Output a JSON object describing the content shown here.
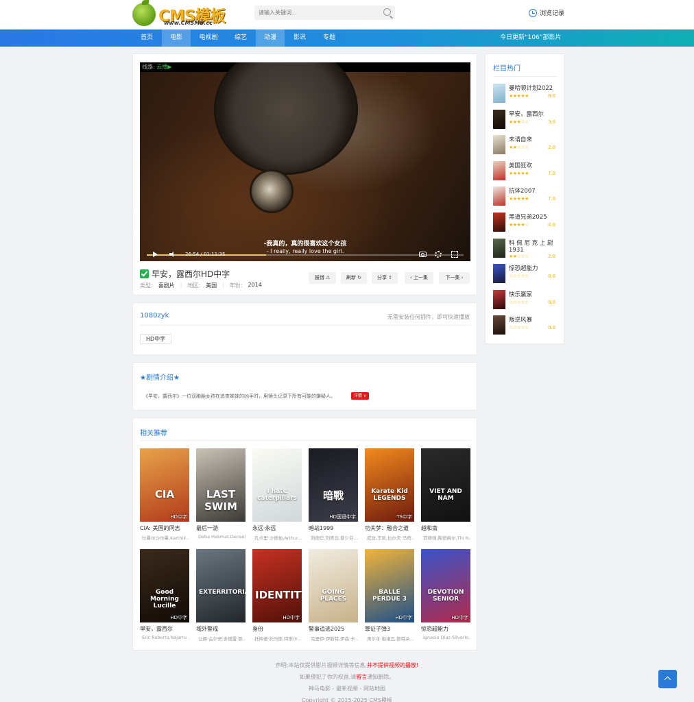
{
  "header": {
    "logo_text": "CMS模板",
    "logo_sub": "www.CMSMB.cc",
    "search_placeholder": "请输入关键词...",
    "history_label": "浏览记录"
  },
  "nav": {
    "items": [
      {
        "label": "首页",
        "active": false
      },
      {
        "label": "电影",
        "active": true
      },
      {
        "label": "电视剧",
        "active": false
      },
      {
        "label": "综艺",
        "active": false
      },
      {
        "label": "动漫",
        "active": true
      },
      {
        "label": "影讯",
        "active": false
      },
      {
        "label": "专题",
        "active": false
      }
    ],
    "update_text": "今日更新“106”部影片"
  },
  "player": {
    "route_label": "线路:",
    "route_name": "云播▶",
    "subtitle_cn": "-我真的，真的很喜欢这个女孩",
    "subtitle_en": "- I really, really love the girl.",
    "time": "26:54 / 01:11:35",
    "progress": 0.376
  },
  "movie": {
    "title": "早安，露西尔HD中字",
    "type_label": "类型:",
    "type_value": "喜剧片",
    "region_label": "地区:",
    "region_value": "美国",
    "year_label": "年份:",
    "year_value": "2014",
    "actions": [
      "报错 ⚠",
      "刷新 ↻",
      "分享 ⇧",
      "‹ 上一集",
      "下一集 ›"
    ]
  },
  "source": {
    "name": "1080zyk",
    "tip": "无需安装任何插件，即可快速播放",
    "episode": "HD中字"
  },
  "intro": {
    "title": "★剧情介绍★",
    "text": "《早安，露西尔》一位双胞胎女孩在追查妹妹的凶手时，用镜头记录下所有可能的嫌疑人。",
    "detail": "详情 ∨"
  },
  "related": {
    "title": "相关推荐",
    "movies": [
      {
        "name": "CIA: 美国的同志",
        "actors": "杜曼尔沙尔曼,Karthik...",
        "badge": "HD中字",
        "art": "CIA",
        "colors": [
          "#e8a34a",
          "#b23a1a"
        ]
      },
      {
        "name": "最后一游",
        "actors": "Deba Hekmat,Densel...",
        "badge": "",
        "art": "LAST SWIM",
        "colors": [
          "#c9c2b6",
          "#3c3a36"
        ]
      },
      {
        "name": "永远·永远",
        "actors": "孔卡里·沙德帕,Arthur...",
        "badge": "",
        "art": "I hate caterpillars",
        "colors": [
          "#fbfbf4",
          "#cfd8da"
        ]
      },
      {
        "name": "暗战1999",
        "actors": "刘德华,刘青云,蔡少芬...",
        "badge": "HD国语中字",
        "art": "暗戰",
        "colors": [
          "#1a1a22",
          "#3d3d4a"
        ]
      },
      {
        "name": "功夫梦：融合之道",
        "actors": "成龙,王凯,拉尔夫·马奇...",
        "badge": "TS中字",
        "art": "Karate Kid LEGENDS",
        "colors": [
          "#f38a1e",
          "#6e1a0c"
        ]
      },
      {
        "name": "越和南",
        "actors": "范德强,陶德梅尔,Thi N...",
        "badge": "",
        "art": "VIET AND NAM",
        "colors": [
          "#2a2a2a",
          "#111"
        ]
      },
      {
        "name": "早安，露西尔",
        "actors": "Eric Roberts,Najarra ...",
        "badge": "HD中字",
        "art": "Good Morning Lucille",
        "colors": [
          "#3a2a1c",
          "#120b06"
        ]
      },
      {
        "name": "域外警戒",
        "actors": "让娜·古尔安,多德雷·斯...",
        "badge": "",
        "art": "EXTERRITORIAL",
        "colors": [
          "#6a7680",
          "#22262a"
        ]
      },
      {
        "name": "身份",
        "actors": "托梅诺·托马斯,特斯尔...",
        "badge": "HD中字",
        "art": "IDENTITY",
        "colors": [
          "#c63122",
          "#521009"
        ]
      },
      {
        "name": "警事追逃2025",
        "actors": "克里伊·伊斯特,伊森·卡...",
        "badge": "",
        "art": "GOING PLACES",
        "colors": [
          "#f1ece0",
          "#c7b28a"
        ]
      },
      {
        "name": "罪证子弹3",
        "actors": "奥尔本·勒维瓦,德特朵...",
        "badge": "HD中字",
        "art": "BALLE PERDUE 3",
        "colors": [
          "#f2b53a",
          "#1c4f8a"
        ]
      },
      {
        "name": "惊恐超能力",
        "actors": "Ignacio Diaz-Silverio,...",
        "badge": "HD中字",
        "art": "DEVOTION SENIOR",
        "colors": [
          "#3a54c9",
          "#b12a4a"
        ]
      }
    ]
  },
  "sidebar": {
    "title": "栏目热门",
    "items": [
      {
        "name": "曼哈顿计划2022",
        "stars": 5,
        "score": "8.0",
        "colors": [
          "#cfe4ef",
          "#7fb1cc"
        ]
      },
      {
        "name": "早安，露西尔",
        "stars": 3,
        "score": "3.0",
        "colors": [
          "#3a2a1c",
          "#120b06"
        ]
      },
      {
        "name": "未请自来",
        "stars": 2,
        "score": "2.0",
        "colors": [
          "#e9e2d2",
          "#8a7a64"
        ]
      },
      {
        "name": "美国狂欢",
        "stars": 5,
        "score": "7.0",
        "colors": [
          "#e8d3c0",
          "#c0302a"
        ]
      },
      {
        "name": "抗体2007",
        "stars": 5,
        "score": "7.0",
        "colors": [
          "#f0e8e0",
          "#b8342a"
        ]
      },
      {
        "name": "黑道兄弟2025",
        "stars": 4,
        "score": "4.0",
        "colors": [
          "#c8321e",
          "#2a1008"
        ]
      },
      {
        "name": "科 佩 尼 克 上 尉 1931",
        "stars": 2,
        "score": "2.0",
        "colors": [
          "#5a6a4a",
          "#1e2418"
        ]
      },
      {
        "name": "惊恐超能力",
        "stars": 0,
        "score": "0.0",
        "colors": [
          "#3a54c9",
          "#1a1a3a"
        ]
      },
      {
        "name": "快乐赢家",
        "stars": 0,
        "score": "0.0",
        "colors": [
          "#c83a3a",
          "#2a0a0a"
        ]
      },
      {
        "name": "叛逆风暴",
        "stars": 0,
        "score": "0.0",
        "colors": [
          "#6a4a3a",
          "#1a0e08"
        ]
      }
    ]
  },
  "footer": {
    "disclaimer_a": "声明:本站仅提供影片视频详情等信息,",
    "disclaimer_b": "并不提供视频的播放!",
    "notice_a": "如果侵犯了你的权益,请",
    "notice_red": "留言",
    "notice_b": "通知删除。",
    "links": "神马电影 - 最新视频 - 网站地图",
    "copyright": "Copyright © 2015-2025 CMS模板"
  },
  "icons": {
    "logo": "apple-logo-icon",
    "search": "search-icon",
    "history": "clock-icon",
    "verified": "check-icon",
    "play": "play-icon",
    "volume": "volume-icon",
    "screenshot": "camera-icon",
    "settings": "gear-icon",
    "fullscreen": "fullscreen-icon",
    "back_to_top": "arrow-up-icon"
  }
}
